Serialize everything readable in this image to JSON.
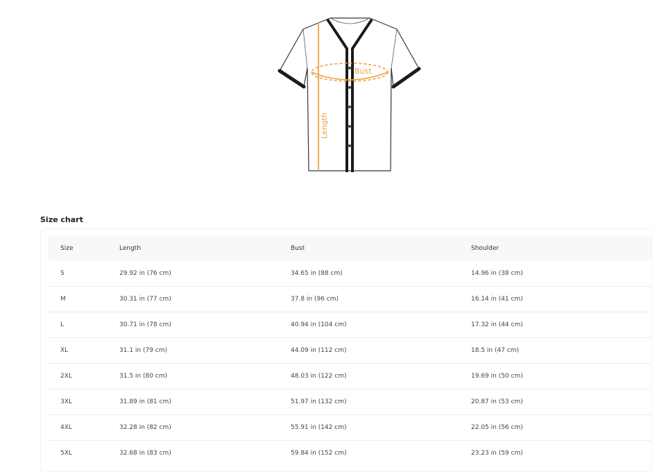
{
  "illustration": {
    "icon": "baseball-jersey-icon",
    "label_bust": "Bust",
    "label_length": "Length",
    "accent_color": "#f0a040"
  },
  "size_chart": {
    "title": "Size chart",
    "columns": [
      "Size",
      "Length",
      "Bust",
      "Shoulder"
    ],
    "rows": [
      {
        "size": "S",
        "length": "29.92 in  (76 cm)",
        "bust": "34.65 in  (88 cm)",
        "shoulder": "14.96 in  (38 cm)"
      },
      {
        "size": "M",
        "length": "30.31 in  (77 cm)",
        "bust": "37.8 in  (96 cm)",
        "shoulder": "16.14 in  (41 cm)"
      },
      {
        "size": "L",
        "length": "30.71 in  (78 cm)",
        "bust": "40.94 in  (104 cm)",
        "shoulder": "17.32 in  (44 cm)"
      },
      {
        "size": "XL",
        "length": "31.1 in  (79 cm)",
        "bust": "44.09 in  (112 cm)",
        "shoulder": "18.5 in  (47 cm)"
      },
      {
        "size": "2XL",
        "length": "31.5 in  (80 cm)",
        "bust": "48.03 in  (122 cm)",
        "shoulder": "19.69 in  (50 cm)"
      },
      {
        "size": "3XL",
        "length": "31.89 in  (81 cm)",
        "bust": "51.97 in  (132 cm)",
        "shoulder": "20.87 in  (53 cm)"
      },
      {
        "size": "4XL",
        "length": "32.28 in  (82 cm)",
        "bust": "55.91 in  (142 cm)",
        "shoulder": "22.05 in  (56 cm)"
      },
      {
        "size": "5XL",
        "length": "32.68 in  (83 cm)",
        "bust": "59.84 in  (152 cm)",
        "shoulder": "23.23 in  (59 cm)"
      }
    ]
  }
}
